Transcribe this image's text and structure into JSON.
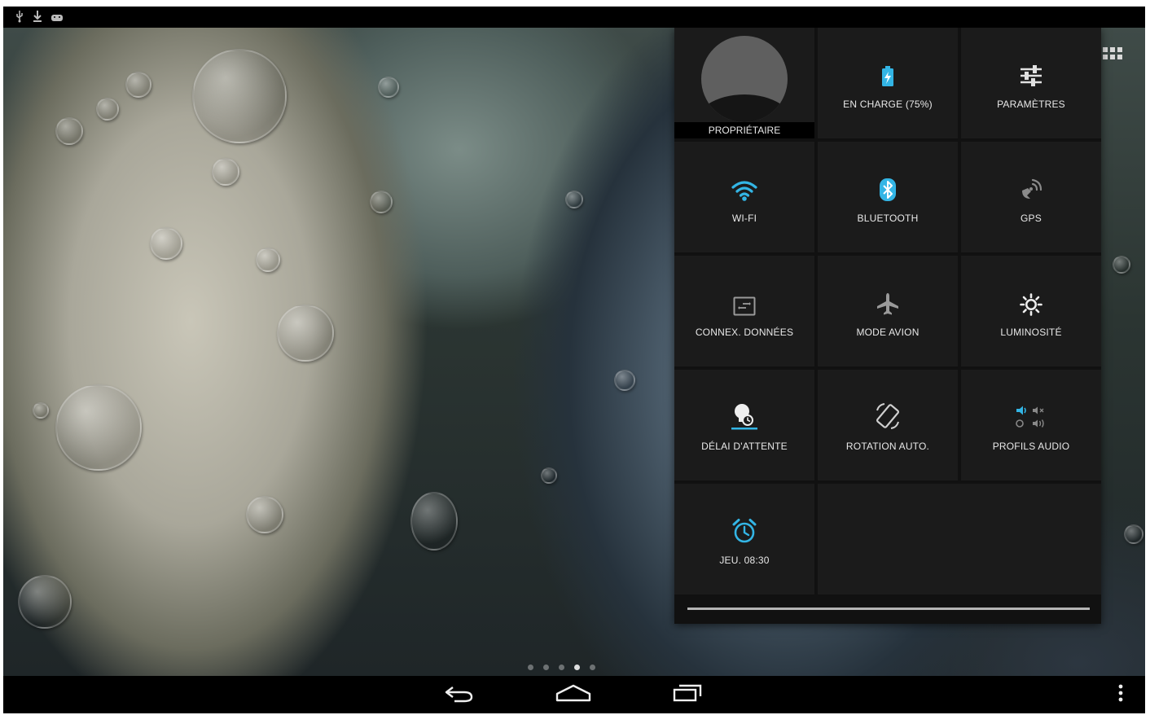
{
  "status_bar": {
    "icons": [
      "usb-icon",
      "download-icon",
      "android-debug-icon"
    ]
  },
  "quick_settings": {
    "owner": {
      "label": "PROPRIÉTAIRE"
    },
    "battery": {
      "label": "EN CHARGE (75%)",
      "level_percent": 75,
      "icon": "battery-charging-icon"
    },
    "settings": {
      "label": "PARAMÈTRES",
      "icon": "settings-sliders-icon"
    },
    "wifi": {
      "label": "WI-FI",
      "icon": "wifi-icon"
    },
    "bluetooth": {
      "label": "BLUETOOTH",
      "icon": "bluetooth-icon"
    },
    "gps": {
      "label": "GPS",
      "icon": "gps-icon"
    },
    "data": {
      "label": "CONNEX. DONNÉES",
      "icon": "data-connection-icon"
    },
    "airplane": {
      "label": "MODE AVION",
      "icon": "airplane-icon"
    },
    "brightness": {
      "label": "LUMINOSITÉ",
      "icon": "brightness-icon"
    },
    "timeout": {
      "label": "DÉLAI D'ATTENTE",
      "icon": "timeout-icon"
    },
    "rotation": {
      "label": "ROTATION AUTO.",
      "icon": "auto-rotate-icon"
    },
    "audio": {
      "label": "PROFILS AUDIO",
      "icon": "audio-profiles-icon"
    },
    "alarm": {
      "label": "JEU. 08:30",
      "icon": "alarm-icon"
    }
  },
  "nav_bar": {
    "buttons": [
      "back-icon",
      "home-icon",
      "recent-apps-icon",
      "menu-overflow-icon"
    ]
  },
  "colors": {
    "accent": "#33b5e5",
    "tile": "#1b1b1b",
    "panel": "#111111"
  }
}
